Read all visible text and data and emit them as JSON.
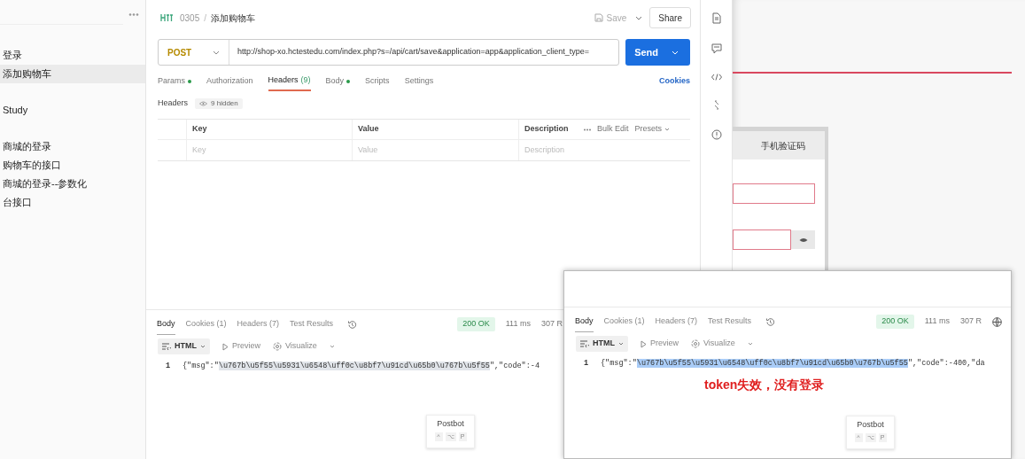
{
  "sidebar": {
    "items": [
      {
        "label": "登录",
        "selected": false
      },
      {
        "label": "添加购物车",
        "selected": true
      },
      {
        "label": "Study",
        "selected": false
      },
      {
        "label": "商城的登录",
        "selected": false
      },
      {
        "label": "购物车的接口",
        "selected": false
      },
      {
        "label": "商城的登录--参数化",
        "selected": false
      },
      {
        "label": "台接口",
        "selected": false
      }
    ]
  },
  "request": {
    "collection": "0305",
    "separator": "/",
    "name": "添加购物车",
    "save": "Save",
    "share": "Share",
    "method": "POST",
    "url": "http://shop-xo.hctestedu.com/index.php?s=/api/cart/save&application=app&application_client_type=",
    "send": "Send",
    "tabs": [
      {
        "label": "Params",
        "dot": true,
        "selected": false
      },
      {
        "label": "Authorization",
        "dot": false,
        "selected": false
      },
      {
        "label": "Headers",
        "count": "(9)",
        "dot": false,
        "selected": true
      },
      {
        "label": "Body",
        "dot": true,
        "selected": false
      },
      {
        "label": "Scripts",
        "dot": false,
        "selected": false
      },
      {
        "label": "Settings",
        "dot": false,
        "selected": false
      }
    ],
    "cookies": "Cookies",
    "headers_title": "Headers",
    "hidden": "9 hidden",
    "columns": [
      "Key",
      "Value",
      "Description"
    ],
    "bulk_edit": "Bulk Edit",
    "presets": "Presets",
    "placeholders": [
      "Key",
      "Value",
      "Description"
    ]
  },
  "response": {
    "tabs": [
      {
        "label": "Body",
        "selected": true
      },
      {
        "label": "Cookies (1)",
        "selected": false
      },
      {
        "label": "Headers (7)",
        "selected": false
      },
      {
        "label": "Test Results",
        "selected": false
      }
    ],
    "status": "200 OK",
    "time": "111 ms",
    "size": "307 R",
    "format": "HTML",
    "preview": "Preview",
    "visualize": "Visualize",
    "line": "1",
    "body_start": "{\"msg\":\"",
    "body_selected": "\\u767b\\u5f55\\u5931\\u6548\\uff0c\\u8bf7\\u91cd\\u65b0\\u767b\\u5f55",
    "body_end": "\",\"code\":-4",
    "selection_focused": false
  },
  "postbot": {
    "title": "Postbot",
    "keys": [
      "^",
      "⌥",
      "P"
    ]
  },
  "browser": {
    "login_tab": "手机验证码"
  },
  "overlay": {
    "response": {
      "tabs": [
        {
          "label": "Body",
          "selected": true
        },
        {
          "label": "Cookies (1)",
          "selected": false
        },
        {
          "label": "Headers (7)",
          "selected": false
        },
        {
          "label": "Test Results",
          "selected": false
        }
      ],
      "status": "200 OK",
      "time": "111 ms",
      "size": "307 R",
      "format": "HTML",
      "preview": "Preview",
      "visualize": "Visualize",
      "line": "1",
      "body_start": "{\"msg\":\"",
      "body_selected": "\\u767b\\u5f55\\u5931\\u6548\\uff0c\\u8bf7\\u91cd\\u65b0\\u767b\\u5f55",
      "body_end": "\",\"code\":-400,\"da",
      "selection_focused": true
    },
    "annotation": "token失效，没有登录",
    "postbot": {
      "title": "Postbot",
      "keys": [
        "^",
        "⌥",
        "P"
      ]
    }
  }
}
